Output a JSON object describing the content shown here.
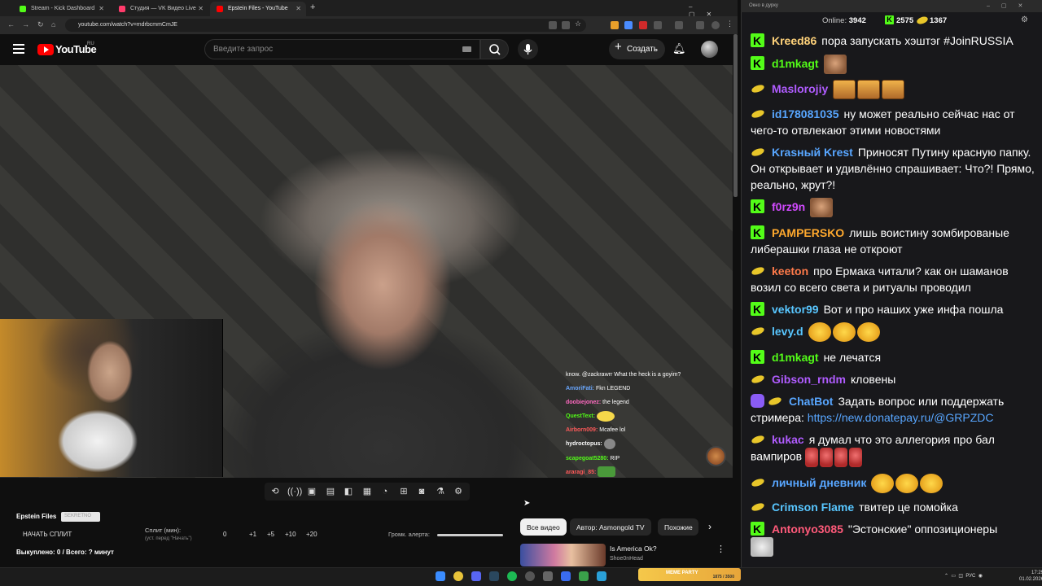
{
  "browser": {
    "tabs": [
      {
        "label": "Stream - Kick Dashboard",
        "color": "#53fc18"
      },
      {
        "label": "Студия — VK Видео Live",
        "color": "#ff3b6b"
      },
      {
        "label": "Epstein Files - YouTube",
        "color": "#ff0000"
      }
    ],
    "url": "youtube.com/watch?v=mdrbcmmCmJE"
  },
  "youtube": {
    "logo_text": "YouTube",
    "region": "RU",
    "search_placeholder": "Введите запрос",
    "create_label": "Создать"
  },
  "video_overlay_chat": [
    {
      "user": "",
      "text": "know. @zackrawrr What the heck is a goyim?",
      "color": "#ffffff"
    },
    {
      "user": "AmoriFati:",
      "text": "Fkn LEGEND",
      "color": "#6aa8ff"
    },
    {
      "user": "doobiejonez:",
      "text": "the legend",
      "color": "#ff6ac1"
    },
    {
      "user": "QuestText:",
      "text": "",
      "color": "#53fc18"
    },
    {
      "user": "Airborn009:",
      "text": "Mcafee lol",
      "color": "#ff5a5a"
    },
    {
      "user": "hydroctopus:",
      "text": "",
      "color": "#ffffff"
    },
    {
      "user": "scapegoat5280:",
      "text": "RIP",
      "color": "#53fc18"
    },
    {
      "user": "araragi_85:",
      "text": "",
      "color": "#ff5a5a"
    }
  ],
  "panel": {
    "title": "Epstein Files",
    "badge": "SEKRETNO",
    "start_split": "НАЧАТЬ СПЛИТ",
    "split_label": "Сплит (мин):",
    "split_hint": "(уст. перед \"Начать\")",
    "split_values": [
      "0",
      "+1",
      "+5",
      "+10",
      "+20"
    ],
    "bought": "Выкуплено: 0 / Всего: ? минут",
    "alert_label": "Громк. алерта:"
  },
  "chips": [
    "Все видео",
    "Автор: Asmongold TV",
    "Похожие"
  ],
  "recommended": {
    "title": "Is America Ok?",
    "channel": "Shoe0nHead"
  },
  "taskbar": {
    "meme_label": "MEME PARTY",
    "meme_count": "1875 / 3500",
    "tray_lang": "РУС",
    "time": "17:29",
    "date": "01.02.2026"
  },
  "chat": {
    "window_title": "Окно в дурку",
    "online_label": "Online:",
    "online_count": "3942",
    "kick_count": "2575",
    "vk_count": "1367",
    "messages": [
      {
        "platform": "kick",
        "nick": "Kreed86",
        "color": "#ffd27a",
        "text": "пора запускать хэштэг #JoinRUSSIA"
      },
      {
        "platform": "kick",
        "nick": "d1mkagt",
        "color": "#53fc18",
        "text": ""
      },
      {
        "platform": "vk",
        "nick": "Maslorojiy",
        "color": "#b05cff",
        "text": ""
      },
      {
        "platform": "vk",
        "nick": "id178081035",
        "color": "#58a6ff",
        "text": "ну может реально сейчас нас от чего-то отвлекают этими новостями"
      },
      {
        "platform": "vk",
        "nick": "Krasный Krest",
        "color": "#58a6ff",
        "text": "Приносят Путину красную папку. Он открывает и удивлённо спрашивает: Что?! Прямо, реально, жрут?!"
      },
      {
        "platform": "kick",
        "nick": "f0rz9n",
        "color": "#d14aff",
        "text": ""
      },
      {
        "platform": "kick",
        "nick": "PAMPERSKO",
        "color": "#ffa92e",
        "text": "лишь воистину зомбированые либерашки глаза не откроют"
      },
      {
        "platform": "vk",
        "nick": "keeton",
        "color": "#ff7a4a",
        "text": "про Ермака читали? как он шаманов возил со всего света и ритуалы проводил"
      },
      {
        "platform": "kick",
        "nick": "vektor99",
        "color": "#58c6ff",
        "text": "Вот и про наших уже инфа пошла"
      },
      {
        "platform": "vk",
        "nick": "levy.d",
        "color": "#58c6ff",
        "text": ""
      },
      {
        "platform": "kick",
        "nick": "d1mkagt",
        "color": "#53fc18",
        "text": "не лечатся"
      },
      {
        "platform": "vk",
        "nick": "Gibson_rndm",
        "color": "#b05cff",
        "text": "кловены"
      },
      {
        "platform": "bot",
        "nick": "ChatBot",
        "color": "#58a6ff",
        "text": "Задать вопрос или поддержать стримера:",
        "link": "https://new.donatepay.ru/@GRPZDC"
      },
      {
        "platform": "vk",
        "nick": "kukac",
        "color": "#b05cff",
        "text": "я думал что это аллегория про бал вампиров"
      },
      {
        "platform": "vk",
        "nick": "личный дневник",
        "color": "#58a6ff",
        "text": ""
      },
      {
        "platform": "vk",
        "nick": "Crimson Flame",
        "color": "#58c6ff",
        "text": "твитер це помойка"
      },
      {
        "platform": "kick",
        "nick": "Antonyo3085",
        "color": "#ff5a7a",
        "text": "\"Эстонские\" оппозиционеры"
      }
    ]
  }
}
